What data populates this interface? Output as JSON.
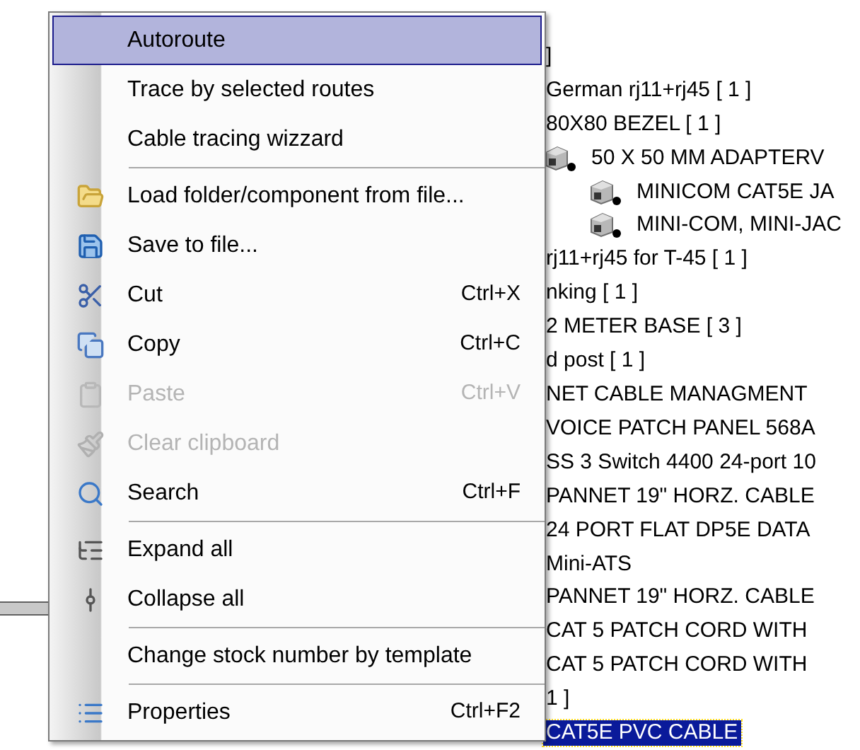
{
  "tree": {
    "items": [
      {
        "kind": "text",
        "label": "]",
        "selected": false
      },
      {
        "kind": "text",
        "label": "German rj11+rj45  [ 1 ]",
        "selected": false
      },
      {
        "kind": "text",
        "label": "80X80 BEZEL  [ 1 ]",
        "selected": false
      },
      {
        "kind": "component",
        "label": "50 X 50 MM ADAPTERV",
        "selected": false,
        "children": [
          {
            "kind": "component",
            "label": "MINICOM CAT5E JA",
            "selected": false
          },
          {
            "kind": "component",
            "label": "MINI-COM, MINI-JAC",
            "selected": false
          }
        ]
      },
      {
        "kind": "text",
        "label": "rj11+rj45 for T-45  [ 1 ]",
        "selected": false
      },
      {
        "kind": "text",
        "label": "nking  [ 1 ]",
        "selected": false
      },
      {
        "kind": "text",
        "label": "2 METER BASE  [ 3 ]",
        "selected": false
      },
      {
        "kind": "text",
        "label": "d post  [ 1 ]",
        "selected": false
      },
      {
        "kind": "text",
        "label": "NET CABLE MANAGMENT",
        "selected": false
      },
      {
        "kind": "text",
        "label": "VOICE PATCH PANEL 568A",
        "selected": false
      },
      {
        "kind": "text",
        "label": "SS 3 Switch 4400 24-port 10",
        "selected": false
      },
      {
        "kind": "text",
        "label": "PANNET 19\" HORZ. CABLE",
        "selected": false
      },
      {
        "kind": "text",
        "label": "24 PORT FLAT DP5E DATA",
        "selected": false
      },
      {
        "kind": "text",
        "label": "Mini-ATS",
        "selected": false
      },
      {
        "kind": "text",
        "label": "PANNET 19\" HORZ. CABLE",
        "selected": false
      },
      {
        "kind": "text",
        "label": "CAT 5 PATCH CORD WITH",
        "selected": false
      },
      {
        "kind": "text",
        "label": "CAT 5 PATCH CORD WITH",
        "selected": false
      },
      {
        "kind": "text",
        "label": "1 ]",
        "selected": false
      },
      {
        "kind": "text",
        "label": "CAT5E PVC CABLE",
        "selected": true
      }
    ]
  },
  "context_menu": {
    "items": [
      {
        "kind": "item",
        "label": "Autoroute",
        "selected": true,
        "disabled": false
      },
      {
        "kind": "item",
        "label": "Trace by selected routes",
        "selected": false,
        "disabled": false
      },
      {
        "kind": "item",
        "label": "Cable tracing wizzard",
        "selected": false,
        "disabled": false
      },
      {
        "kind": "separator"
      },
      {
        "kind": "item",
        "label": "Load folder/component from file...",
        "selected": false,
        "disabled": false
      },
      {
        "kind": "item",
        "label": "Save to file...",
        "selected": false,
        "disabled": false
      },
      {
        "kind": "item",
        "label": "Cut",
        "shortcut": "Ctrl+X",
        "selected": false,
        "disabled": false
      },
      {
        "kind": "item",
        "label": "Copy",
        "shortcut": "Ctrl+C",
        "selected": false,
        "disabled": false
      },
      {
        "kind": "item",
        "label": "Paste",
        "shortcut": "Ctrl+V",
        "selected": false,
        "disabled": true
      },
      {
        "kind": "item",
        "label": "Clear clipboard",
        "selected": false,
        "disabled": true
      },
      {
        "kind": "item",
        "label": "Search",
        "shortcut": "Ctrl+F",
        "selected": false,
        "disabled": false
      },
      {
        "kind": "separator"
      },
      {
        "kind": "item",
        "label": "Expand all",
        "selected": false,
        "disabled": false
      },
      {
        "kind": "item",
        "label": "Collapse all",
        "selected": false,
        "disabled": false
      },
      {
        "kind": "separator"
      },
      {
        "kind": "item",
        "label": "Change stock number by template",
        "selected": false,
        "disabled": false
      },
      {
        "kind": "separator"
      },
      {
        "kind": "item",
        "label": "Properties",
        "shortcut": "Ctrl+F2",
        "selected": false,
        "disabled": false
      }
    ]
  }
}
